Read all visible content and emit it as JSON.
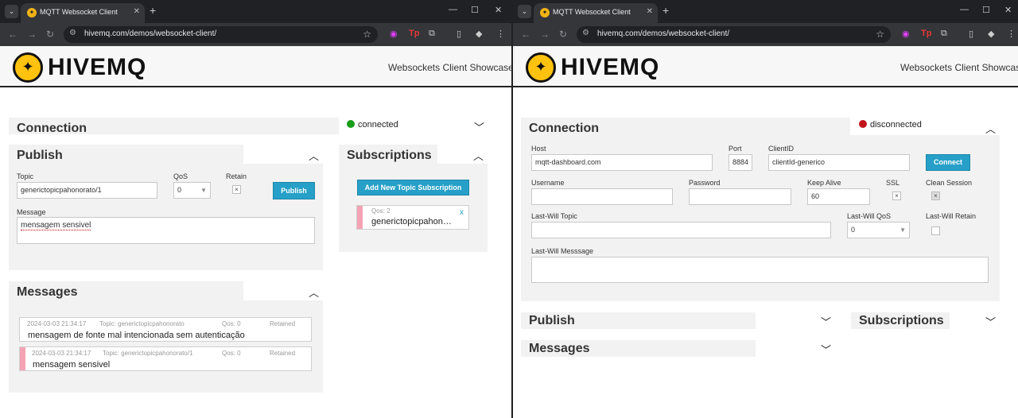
{
  "browser": {
    "tab_title": "MQTT Websocket Client",
    "url": "hivemq.com/demos/websocket-client/"
  },
  "header": {
    "logo_text": "HIVEMQ",
    "showcase": "Websockets Client Showcase"
  },
  "left": {
    "connection_title": "Connection",
    "status": "connected",
    "status_color": "#1a9e1a",
    "publish": {
      "title": "Publish",
      "topic_label": "Topic",
      "topic_value": "generictopicpahonorato/1",
      "qos_label": "QoS",
      "qos_value": "0",
      "retain_label": "Retain",
      "button": "Publish",
      "message_label": "Message",
      "message_value": "mensagem sensivel"
    },
    "subscriptions": {
      "title": "Subscriptions",
      "add_button": "Add New Topic Subscription",
      "items": [
        {
          "qos": "Qos: 2",
          "topic": "generictopicpahon…",
          "close": "x",
          "color": "#f4a3b4"
        }
      ]
    },
    "messages": {
      "title": "Messages",
      "items": [
        {
          "time": "2024-03-03 21:34:17",
          "topic": "Topic: generictopicpahonorato",
          "qos": "Qos: 0",
          "retained": "Retained",
          "text": "mensagem de fonte mal intencionada sem autenticação",
          "color": "#ffffff"
        },
        {
          "time": "2024-03-03 21:34:17",
          "topic": "Topic: generictopicpahonorato/1",
          "qos": "Qos: 0",
          "retained": "Retained",
          "text": "mensagem sensivel",
          "color": "#f4a3b4"
        }
      ]
    }
  },
  "right": {
    "connection_title": "Connection",
    "status": "disconnected",
    "status_color": "#c0141a",
    "host_label": "Host",
    "host_value": "mqtt-dashboard.com",
    "port_label": "Port",
    "port_value": "8884",
    "clientid_label": "ClientID",
    "clientid_value": "clientId-generico",
    "connect_button": "Connect",
    "username_label": "Username",
    "password_label": "Password",
    "keepalive_label": "Keep Alive",
    "keepalive_value": "60",
    "ssl_label": "SSL",
    "clean_label": "Clean Session",
    "lwt_label": "Last-Will Topic",
    "lwqos_label": "Last-Will QoS",
    "lwqos_value": "0",
    "lwretain_label": "Last-Will Retain",
    "lwmsg_label": "Last-Will Messsage",
    "publish_title": "Publish",
    "subscriptions_title": "Subscriptions",
    "messages_title": "Messages"
  }
}
